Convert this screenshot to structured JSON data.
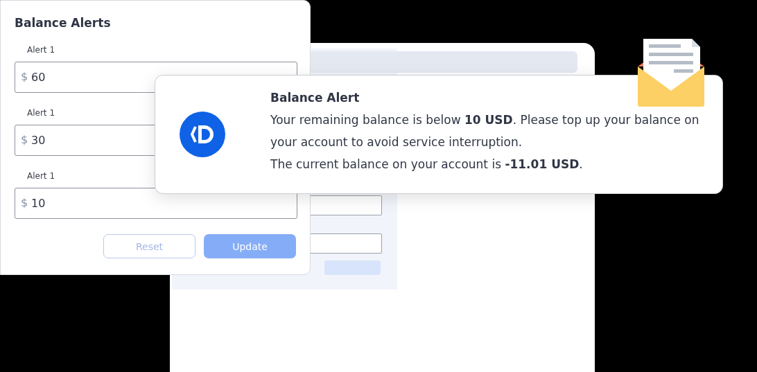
{
  "settings_card": {
    "title": "Balance Alerts",
    "alerts": [
      {
        "label": "Alert 1",
        "currency": "$",
        "value": "60"
      },
      {
        "label": "Alert 1",
        "currency": "$",
        "value": "30"
      },
      {
        "label": "Alert 1",
        "currency": "$",
        "value": "10"
      }
    ],
    "buttons": [
      {
        "label": "Reset",
        "kind": "secondary",
        "disabled": true
      },
      {
        "label": "Update",
        "kind": "primary",
        "disabled": true
      }
    ]
  },
  "notification": {
    "title": "Balance Alert",
    "paragraphs": [
      "Your remaining balance is below **10 USD**. Please top up your balance on your account to avoid service interruption.",
      "The current balance on your account is **-11.01 USD**."
    ]
  }
}
